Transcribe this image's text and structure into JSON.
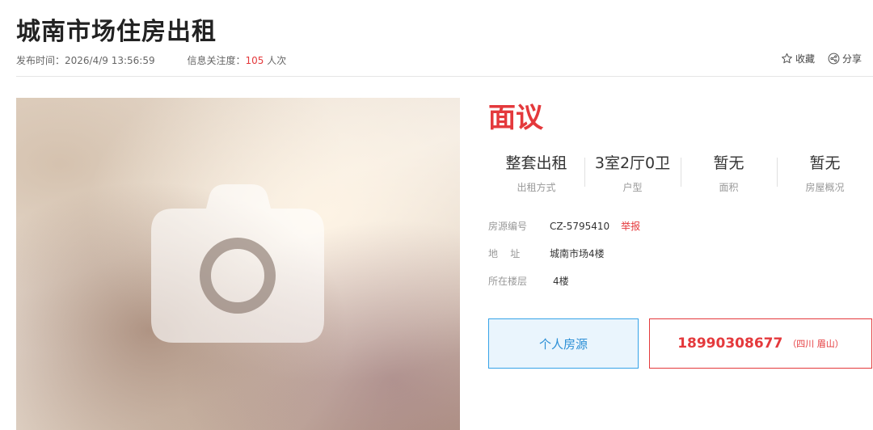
{
  "page": {
    "title": "城南市场住房出租",
    "publish_label": "发布时间：",
    "publish_time": "2026/4/9 13:56:59",
    "views_label": "信息关注度：",
    "views_count": "105",
    "views_unit": " 人次"
  },
  "actions": {
    "favorite": "收藏",
    "share": "分享"
  },
  "listing": {
    "price": "面议",
    "specs": [
      {
        "value": "整套出租",
        "label": "出租方式"
      },
      {
        "value": "3室2厅0卫",
        "label": "户型"
      },
      {
        "value": "暂无",
        "label": "面积"
      },
      {
        "value": "暂无",
        "label": "房屋概况"
      }
    ],
    "listing_no_label": "房源编号",
    "listing_no": "CZ-5795410",
    "report": "举报",
    "address_label": "地    址",
    "address": "城南市场4楼",
    "floor_label": "所在楼层",
    "floor": "4楼"
  },
  "contact": {
    "source_button": "个人房源",
    "phone": "18990308677",
    "location": "（四川 眉山）"
  },
  "colors": {
    "accent_red": "#e4393c",
    "accent_blue": "#36a3e8"
  }
}
